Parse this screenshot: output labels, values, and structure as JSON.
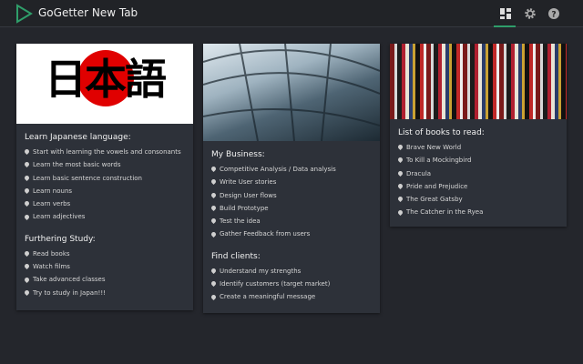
{
  "header": {
    "title": "GoGetter New Tab",
    "icons": [
      "dashboard-icon",
      "gear-icon",
      "help-icon"
    ]
  },
  "colors": {
    "accent": "#2f9e6a",
    "card": "#2d3139",
    "background": "#24262c"
  },
  "cards": [
    {
      "image_text": "日本語",
      "sections": [
        {
          "heading": "Learn Japanese language:",
          "items": [
            "Start with learning the vowels and consonants",
            "Learn the most basic words",
            "Learn basic sentence construction",
            "Learn nouns",
            "Learn verbs",
            "Learn adjectives"
          ]
        },
        {
          "heading": "Furthering Study:",
          "items": [
            "Read books",
            "Watch films",
            "Take advanced classes",
            "Try to study in Japan!!!"
          ]
        }
      ]
    },
    {
      "sections": [
        {
          "heading": "My Business:",
          "items": [
            "Competitive Analysis / Data analysis",
            "Write User stories",
            "Design User flows",
            "Build Prototype",
            "Test the idea",
            "Gather Feedback from users"
          ]
        },
        {
          "heading": "Find clients:",
          "items": [
            "Understand my strengths",
            "Identify customers (target market)",
            "Create a meaningful message"
          ]
        }
      ]
    },
    {
      "sections": [
        {
          "heading": "List of books to read:",
          "items": [
            "Brave New World",
            "To Kill a Mockingbird",
            "Dracula",
            "Pride and Prejudice",
            "The Great Gatsby",
            "The Catcher in the Ryea"
          ]
        }
      ]
    }
  ]
}
